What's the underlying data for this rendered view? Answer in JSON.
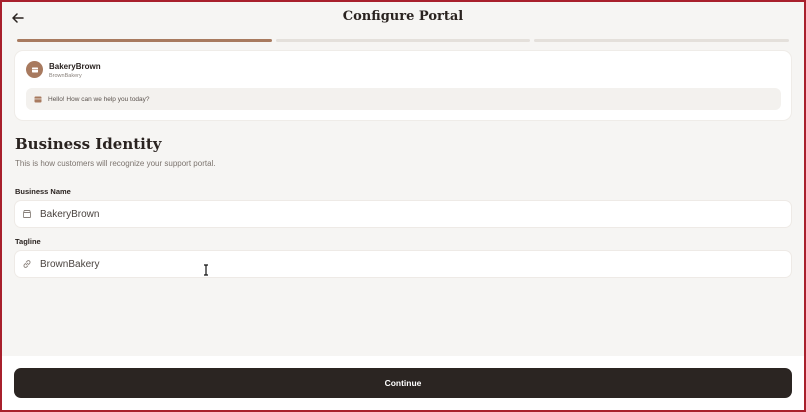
{
  "header": {
    "title": "Configure Portal"
  },
  "progress": {
    "total_steps": 3,
    "current_step": 1
  },
  "preview": {
    "brand_name": "BakeryBrown",
    "brand_tagline": "BrownBakery",
    "greeting": "Hello! How can we help you today?"
  },
  "section": {
    "title": "Business Identity",
    "description": "This is how customers will recognize your support portal."
  },
  "fields": {
    "business_name": {
      "label": "Business Name",
      "value": "BakeryBrown",
      "icon": "store-icon"
    },
    "tagline": {
      "label": "Tagline",
      "value": "BrownBakery",
      "icon": "link-icon"
    }
  },
  "footer": {
    "continue_label": "Continue"
  },
  "colors": {
    "accent": "#a87a5f",
    "button": "#2b2522",
    "background": "#f6f5f3",
    "border": "#a8202c"
  }
}
